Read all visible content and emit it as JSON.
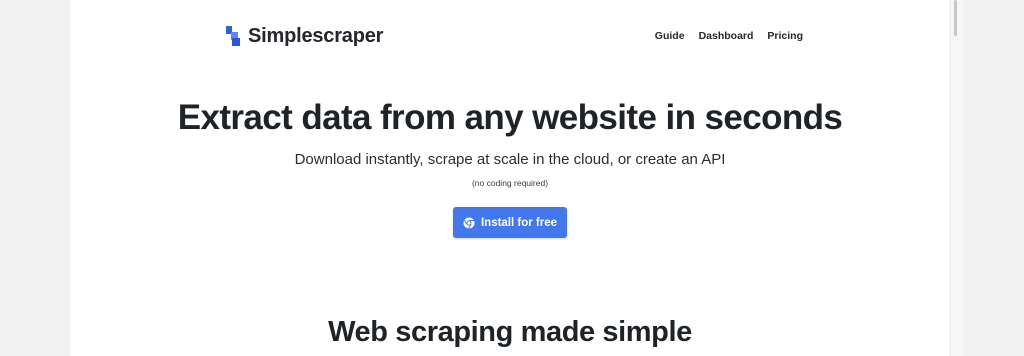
{
  "header": {
    "brand": "Simplescraper",
    "nav": [
      "Guide",
      "Dashboard",
      "Pricing"
    ]
  },
  "hero": {
    "title": "Extract data from any website in seconds",
    "subtitle": "Download instantly, scrape at scale in the cloud, or create an API",
    "note": "(no coding required)",
    "cta_label": "Install for free",
    "cta_icon": "chrome-icon"
  },
  "section": {
    "title": "Web scraping made simple"
  },
  "colors": {
    "accent": "#4277ee",
    "logo_dark": "#2f5fe0",
    "logo_light": "#5a86ff",
    "text": "#1f2328"
  }
}
